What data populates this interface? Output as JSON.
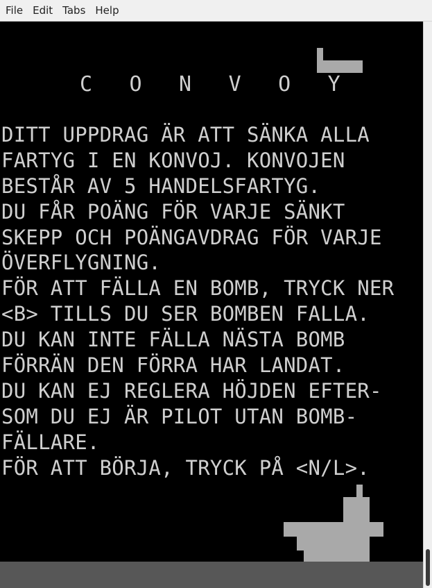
{
  "menubar": {
    "items": [
      "File",
      "Edit",
      "Tabs",
      "Help"
    ]
  },
  "game": {
    "title": "C O N V O Y   B O M B",
    "instructions": [
      "DITT UPPDRAG ÄR ATT SÄNKA ALLA",
      "FARTYG I EN KONVOJ. KONVOJEN",
      "BESTÅR AV 5 HANDELSFARTYG.",
      "DU FÅR POÄNG FÖR VARJE SÄNKT",
      "SKEPP OCH POÄNGAVDRAG FÖR VARJE",
      "ÖVERFLYGNING.",
      "FÖR ATT FÄLLA EN BOMB, TRYCK NER",
      "<B> TILLS DU SER BOMBEN FALLA.",
      "DU KAN INTE FÄLLA NÄSTA BOMB",
      "FÖRRÄN DEN FÖRRA HAR LANDAT.",
      "DU KAN EJ REGLERA HÖJDEN EFTER-",
      "SOM DU EJ ÄR PILOT UTAN BOMB-",
      "FÄLLARE.",
      "FÖR ATT BÖRJA, TRYCK PÅ <N/L>."
    ]
  },
  "colors": {
    "screen_background": "#000000",
    "text": "#cfcfcf",
    "sprites": "#a9a9a9",
    "ground": "#575757",
    "menubar_background": "#f0f0f0"
  }
}
